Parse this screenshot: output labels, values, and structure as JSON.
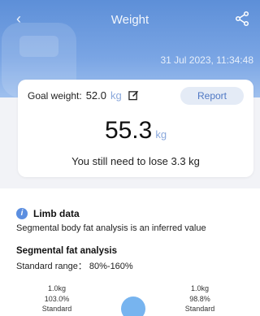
{
  "header": {
    "title": "Weight",
    "datetime": "31 Jul 2023, 11:34:48"
  },
  "goal": {
    "label": "Goal weight:",
    "value": "52.0",
    "unit": "kg",
    "report_label": "Report"
  },
  "current": {
    "weight": "55.3",
    "unit": "kg",
    "hint": "You still need to lose 3.3 kg"
  },
  "limb": {
    "title": "Limb data",
    "subtitle": "Segmental body fat analysis is an inferred value",
    "segment_title": "Segmental fat analysis",
    "standard_range": "Standard range： 80%-160%",
    "left": {
      "mass": "1.0kg",
      "percent": "103.0%",
      "status": "Standard"
    },
    "right": {
      "mass": "1.0kg",
      "percent": "98.8%",
      "status": "Standard"
    }
  },
  "colors": {
    "header": "#5d8fd8",
    "accent": "#4f78c4",
    "unit": "#8aa8dc",
    "body_dot": "#5fa7ec"
  }
}
